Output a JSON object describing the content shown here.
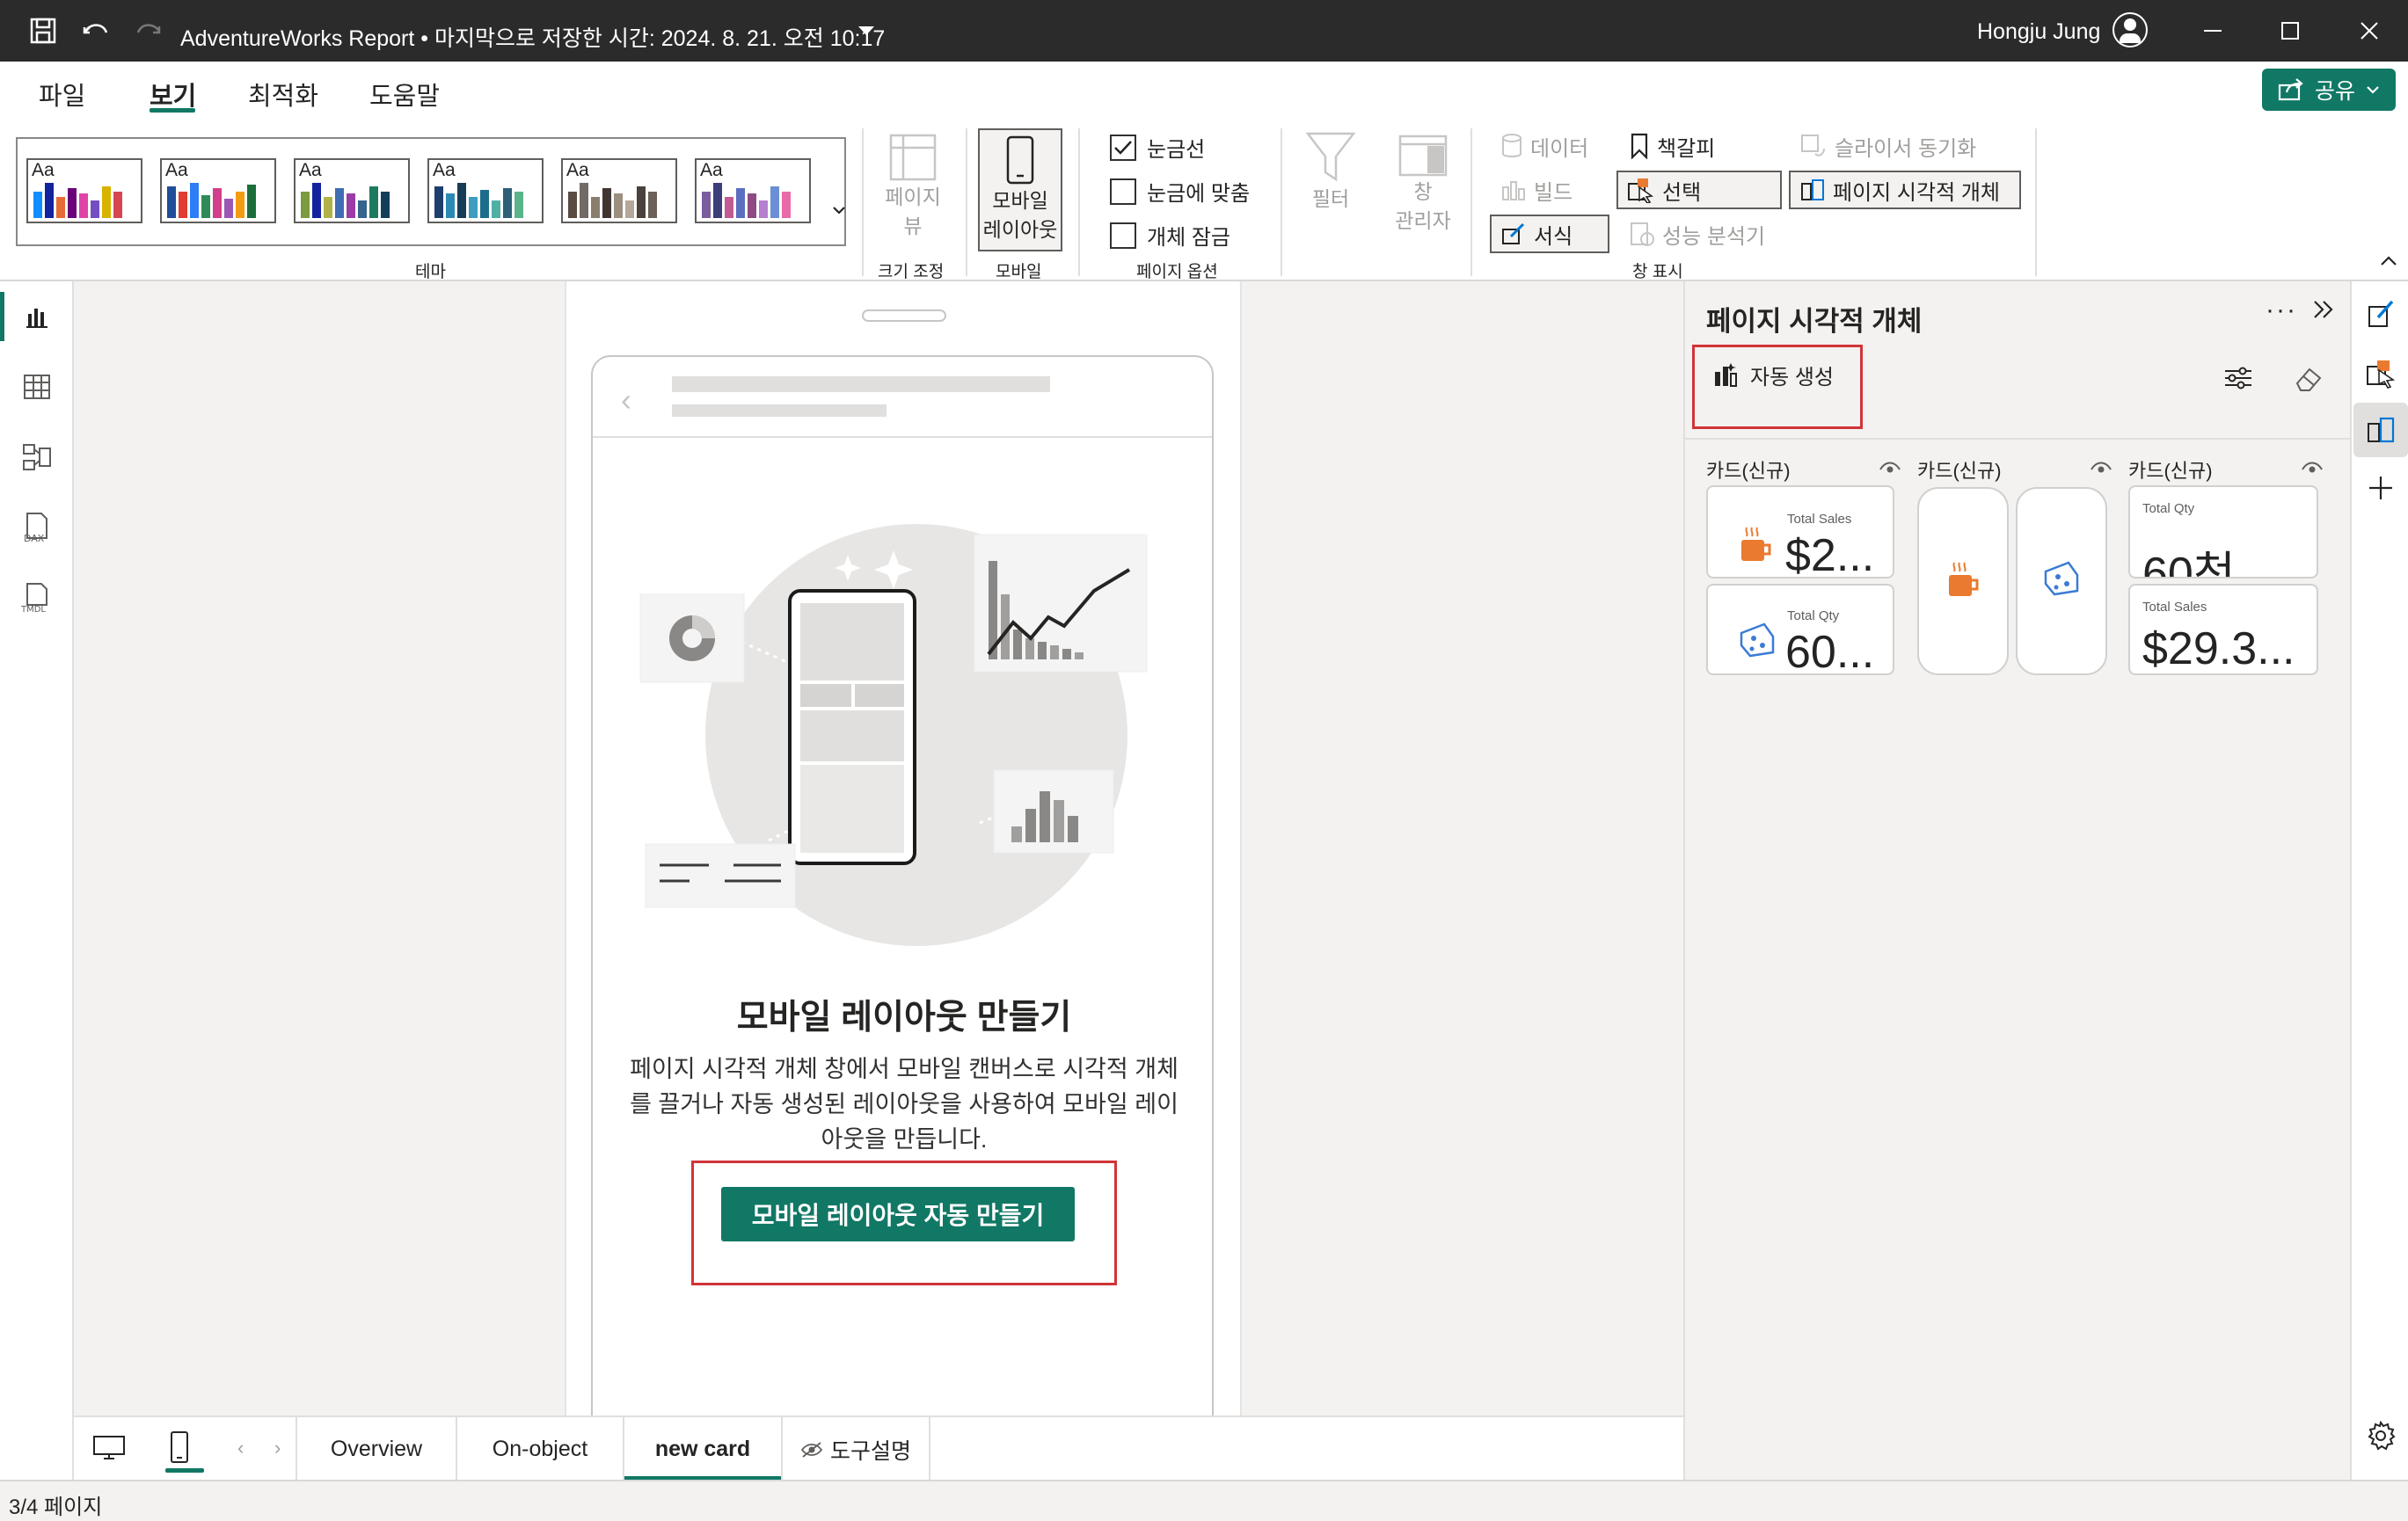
{
  "titlebar": {
    "title": "AdventureWorks Report • 마지막으로 저장한 시간: 2024. 8. 21. 오전 10:17",
    "user": "Hongju Jung"
  },
  "menu": {
    "tabs": [
      {
        "label": "파일"
      },
      {
        "label": "보기",
        "active": true
      },
      {
        "label": "최적화"
      },
      {
        "label": "도움말"
      }
    ],
    "share_label": "공유"
  },
  "ribbon": {
    "themes_label": "테마",
    "theme_swatch_text": "Aa",
    "page_view": {
      "label1": "페이지",
      "label2": "뷰",
      "group": "크기 조정"
    },
    "mobile": {
      "label1": "모바일",
      "label2": "레이아웃",
      "group": "모바일"
    },
    "page_options": {
      "gridlines": "눈금선",
      "snap": "눈금에 맞춤",
      "lock": "개체 잠금",
      "group": "페이지 옵션"
    },
    "filter_label": "필터",
    "window_manager": {
      "label1": "창",
      "label2": "관리자"
    },
    "show_panes": {
      "data": "데이터",
      "build": "빌드",
      "format": "서식",
      "bookmarks": "책갈피",
      "selection": "선택",
      "perf": "성능 분석기",
      "sync": "슬라이서 동기화",
      "page_visuals": "페이지 시각적 개체",
      "group": "창 표시"
    }
  },
  "canvas": {
    "empty_title": "모바일 레이아웃 만들기",
    "empty_desc_1": "페이지 시각적 개체 창에서 모바일 캔버스로 시각적 개체",
    "empty_desc_2": "를 끌거나 자동 생성된 레이아웃을 사용하여 모바일 레이",
    "empty_desc_3": "아웃을 만듭니다.",
    "auto_button": "모바일 레이아웃 자동 만들기"
  },
  "page_tabs": [
    {
      "label": "Overview"
    },
    {
      "label": "On-object"
    },
    {
      "label": "new card",
      "active": true
    },
    {
      "label": "도구설명",
      "hidden": true
    }
  ],
  "pane": {
    "title": "페이지 시각적 개체",
    "more": "···",
    "autogen": "자동 생성",
    "visuals": [
      {
        "header": "카드(신규)",
        "cards": [
          {
            "label": "Total Sales",
            "value": "$2..."
          },
          {
            "label": "Total Qty",
            "value": "60..."
          }
        ]
      },
      {
        "header": "카드(신규)",
        "cards": []
      },
      {
        "header": "카드(신규)",
        "cards": [
          {
            "label": "Total Qty",
            "value": "60천"
          },
          {
            "label": "Total Sales",
            "value": "$29.3..."
          }
        ]
      }
    ]
  },
  "status": {
    "page": "3/4 페이지"
  },
  "colors": {
    "accent": "#117865",
    "highlight": "#d13438",
    "coffee": "#ea7a2f",
    "cheese": "#4a90d9"
  }
}
